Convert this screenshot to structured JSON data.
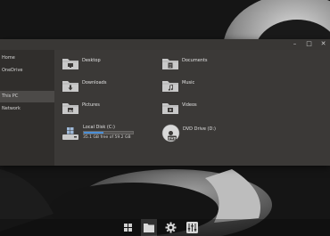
{
  "window": {
    "controls": [
      "–",
      "□",
      "✕"
    ]
  },
  "sidebar": {
    "items": [
      {
        "label": "Home"
      },
      {
        "label": "OneDrive"
      },
      {
        "label": "This PC",
        "active": true
      },
      {
        "label": "Network"
      }
    ]
  },
  "folders": [
    {
      "label": "Desktop",
      "icon": "desktop-folder-icon"
    },
    {
      "label": "Documents",
      "icon": "documents-folder-icon"
    },
    {
      "label": "Downloads",
      "icon": "downloads-folder-icon"
    },
    {
      "label": "Music",
      "icon": "music-folder-icon"
    },
    {
      "label": "Pictures",
      "icon": "pictures-folder-icon"
    },
    {
      "label": "Videos",
      "icon": "videos-folder-icon"
    }
  ],
  "drives": {
    "local": {
      "name": "Local Disk (C:)",
      "free_text": "35.1 GB free of 59.2 GB",
      "used_fraction": 0.407,
      "bar_color": "#4a8fd8"
    },
    "dvd": {
      "name": "DVD Drive (D:)",
      "icon_label": "DVD"
    }
  },
  "taskbar": {
    "items": [
      {
        "icon": "start-windows-icon"
      },
      {
        "icon": "file-explorer-icon",
        "active": true
      },
      {
        "icon": "settings-gear-icon"
      },
      {
        "icon": "sliders-mixer-icon"
      }
    ]
  },
  "colors": {
    "window_bg": "#3b3937",
    "sidebar_bg": "#302e2c",
    "active_nav_bg": "#4c4a48",
    "folder_color": "#c9c9c9"
  }
}
